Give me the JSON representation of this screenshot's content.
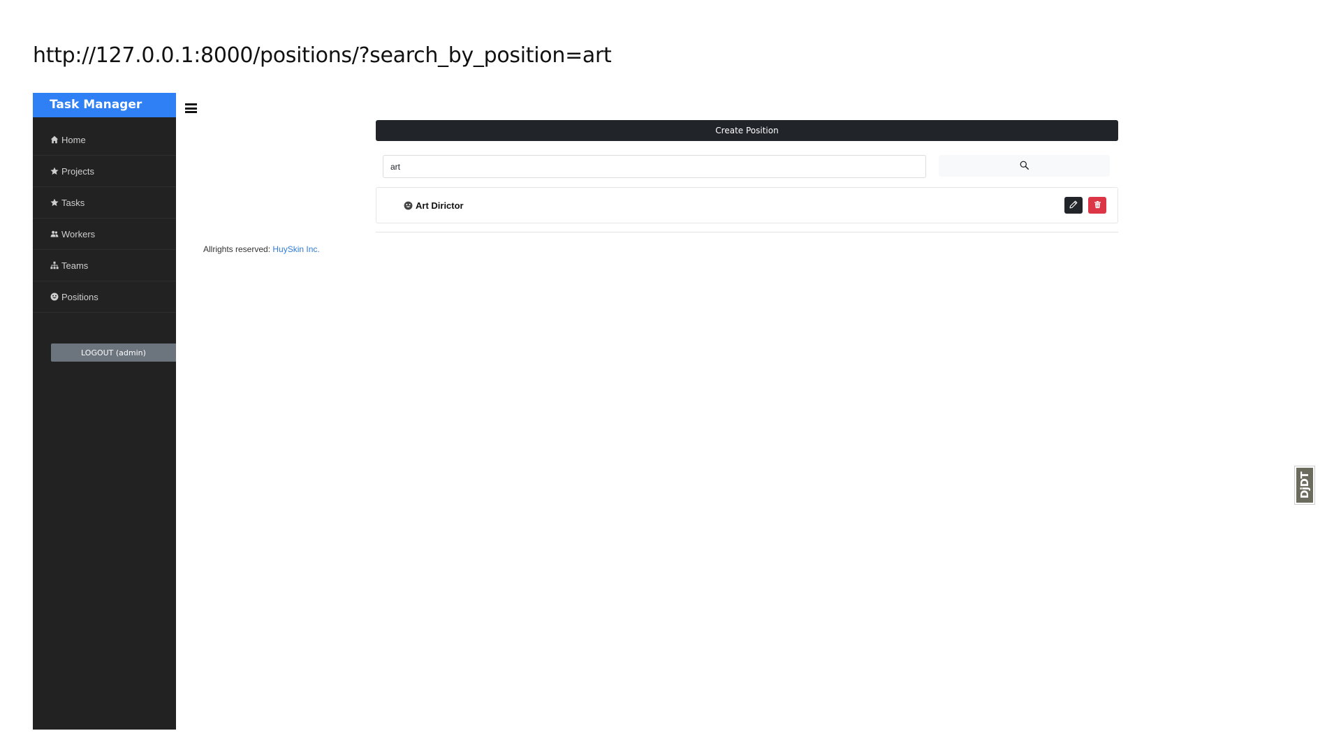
{
  "url_caption": "http://127.0.0.1:8000/positions/?search_by_position=art",
  "sidebar": {
    "brand": "Task Manager",
    "items": [
      {
        "label": "Home",
        "icon": "home-icon"
      },
      {
        "label": "Projects",
        "icon": "star-icon"
      },
      {
        "label": "Tasks",
        "icon": "star-icon"
      },
      {
        "label": "Workers",
        "icon": "users-icon"
      },
      {
        "label": "Teams",
        "icon": "sitemap-icon"
      },
      {
        "label": "Positions",
        "icon": "smile-icon"
      }
    ],
    "logout_label": "LOGOUT (admin)"
  },
  "header": {
    "menu_icon": "hamburger-icon"
  },
  "main": {
    "create_label": "Create Position",
    "search": {
      "value": "art",
      "button_icon": "search-icon"
    },
    "results": [
      {
        "name": "Art Dirictor",
        "icon": "smile-icon"
      }
    ]
  },
  "footer": {
    "text": "Allrights reserved:",
    "link": "HuySkin Inc."
  },
  "debug_toolbar": {
    "label": "DjDT"
  },
  "colors": {
    "sidebar_bg": "#222222",
    "brand_bg": "#2f80f5",
    "dark": "#212529",
    "danger": "#dc3545",
    "secondary": "#6c757d",
    "link": "#2f7bd6"
  }
}
